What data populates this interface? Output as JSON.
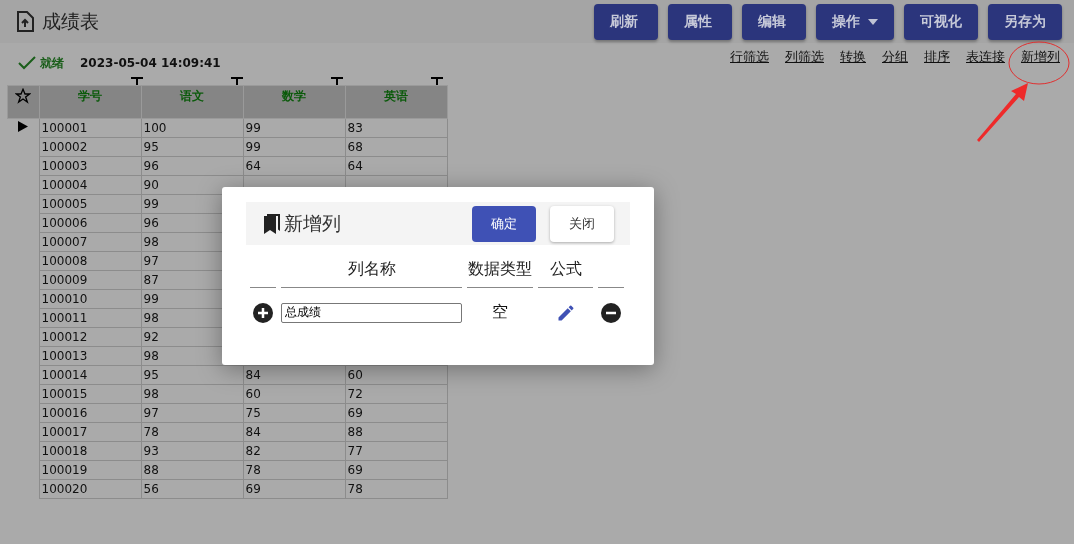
{
  "header": {
    "title": "成绩表"
  },
  "toolbar": {
    "buttons": [
      {
        "label": "刷新",
        "kind": "plain"
      },
      {
        "label": "属性",
        "kind": "plain"
      },
      {
        "label": "编辑",
        "kind": "plain"
      },
      {
        "label": "操作",
        "kind": "dropdown"
      },
      {
        "label": "可视化",
        "kind": "plain"
      },
      {
        "label": "另存为",
        "kind": "plain"
      }
    ]
  },
  "status": {
    "text": "就绪",
    "time": "2023-05-04 14:09:41"
  },
  "links": [
    "行筛选",
    "列筛选",
    "转换",
    "分组",
    "排序",
    "表连接",
    "新增列"
  ],
  "table": {
    "columns": [
      "学号",
      "语文",
      "数学",
      "英语"
    ],
    "rows": [
      {
        "selected": true,
        "cells": [
          "100001",
          "100",
          "99",
          "83"
        ]
      },
      {
        "selected": false,
        "cells": [
          "100002",
          "95",
          "99",
          "68"
        ]
      },
      {
        "selected": false,
        "cells": [
          "100003",
          "96",
          "64",
          "64"
        ]
      },
      {
        "selected": false,
        "cells": [
          "100004",
          "90"
        ]
      },
      {
        "selected": false,
        "cells": [
          "100005",
          "99"
        ]
      },
      {
        "selected": false,
        "cells": [
          "100006",
          "96"
        ]
      },
      {
        "selected": false,
        "cells": [
          "100007",
          "98"
        ]
      },
      {
        "selected": false,
        "cells": [
          "100008",
          "97"
        ]
      },
      {
        "selected": false,
        "cells": [
          "100009",
          "87"
        ]
      },
      {
        "selected": false,
        "cells": [
          "100010",
          "99"
        ]
      },
      {
        "selected": false,
        "cells": [
          "100011",
          "98"
        ]
      },
      {
        "selected": false,
        "cells": [
          "100012",
          "92"
        ]
      },
      {
        "selected": false,
        "cells": [
          "100013",
          "98"
        ]
      },
      {
        "selected": false,
        "cells": [
          "100014",
          "95",
          "84",
          "60"
        ]
      },
      {
        "selected": false,
        "cells": [
          "100015",
          "98",
          "60",
          "72"
        ]
      },
      {
        "selected": false,
        "cells": [
          "100016",
          "97",
          "75",
          "69"
        ]
      },
      {
        "selected": false,
        "cells": [
          "100017",
          "78",
          "84",
          "88"
        ]
      },
      {
        "selected": false,
        "cells": [
          "100018",
          "93",
          "82",
          "77"
        ]
      },
      {
        "selected": false,
        "cells": [
          "100019",
          "88",
          "78",
          "69"
        ]
      },
      {
        "selected": false,
        "cells": [
          "100020",
          "56",
          "69",
          "78"
        ]
      }
    ]
  },
  "dialog": {
    "title": "新增列",
    "confirm": "确定",
    "close": "关闭",
    "columns": [
      "列名称",
      "数据类型",
      "公式"
    ],
    "rows": [
      {
        "name": "总成绩",
        "type": "空"
      }
    ]
  }
}
